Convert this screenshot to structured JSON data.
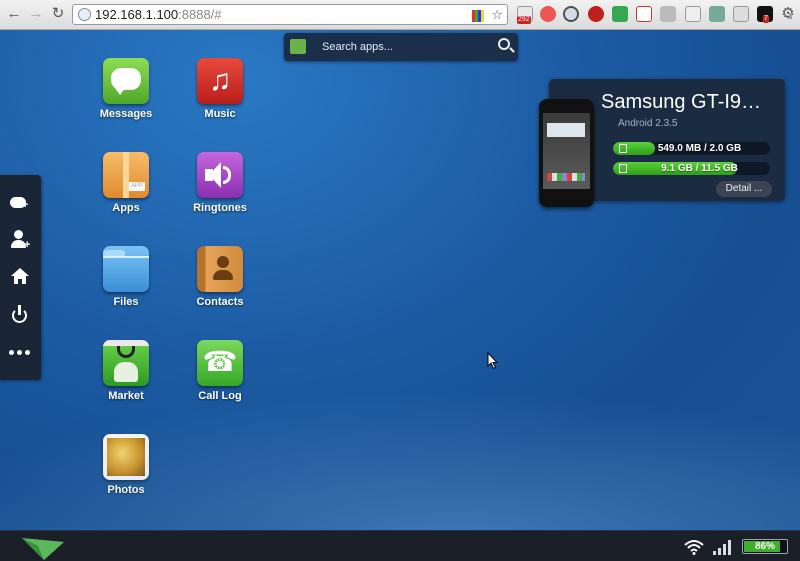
{
  "browser": {
    "url_host": "192.168.1.100",
    "url_rest": ":8888/#",
    "extension_badges": {
      "counter": "292",
      "notifications": "7"
    }
  },
  "search": {
    "placeholder": "Search apps..."
  },
  "apps": [
    {
      "label": "Messages",
      "icon": "messages-icon",
      "color": "#6ec43f"
    },
    {
      "label": "Music",
      "icon": "music-icon",
      "color": "#d7322a"
    },
    {
      "label": "Apps",
      "icon": "apps-box-icon",
      "color": "#f0a04a"
    },
    {
      "label": "Ringtones",
      "icon": "speaker-icon",
      "color": "#a54fc4"
    },
    {
      "label": "Files",
      "icon": "folder-icon",
      "color": "#4aa0e8"
    },
    {
      "label": "Contacts",
      "icon": "contacts-icon",
      "color": "#d08b3c"
    },
    {
      "label": "Market",
      "icon": "market-bag-icon",
      "color": "#3aa832"
    },
    {
      "label": "Call Log",
      "icon": "phone-icon",
      "color": "#4fbf3d"
    },
    {
      "label": "Photos",
      "icon": "photos-icon",
      "color": "#c9922b"
    }
  ],
  "sidebar": [
    {
      "icon": "new-message-icon"
    },
    {
      "icon": "add-contact-icon"
    },
    {
      "icon": "home-icon"
    },
    {
      "icon": "power-icon"
    },
    {
      "icon": "more-icon"
    }
  ],
  "device": {
    "name": "Samsung GT-I9…",
    "os": "Android 2.3.5",
    "storage": [
      {
        "text": "549.0 MB / 2.0 GB",
        "fill": 0.27,
        "icon": "sd-card-icon"
      },
      {
        "text": "9.1 GB / 11.5 GB",
        "fill": 0.79,
        "icon": "storage-icon"
      }
    ],
    "detail_button": "Detail ..."
  },
  "statusbar": {
    "battery": "86%",
    "battery_level": 0.86,
    "accent": "#3fae2a"
  }
}
